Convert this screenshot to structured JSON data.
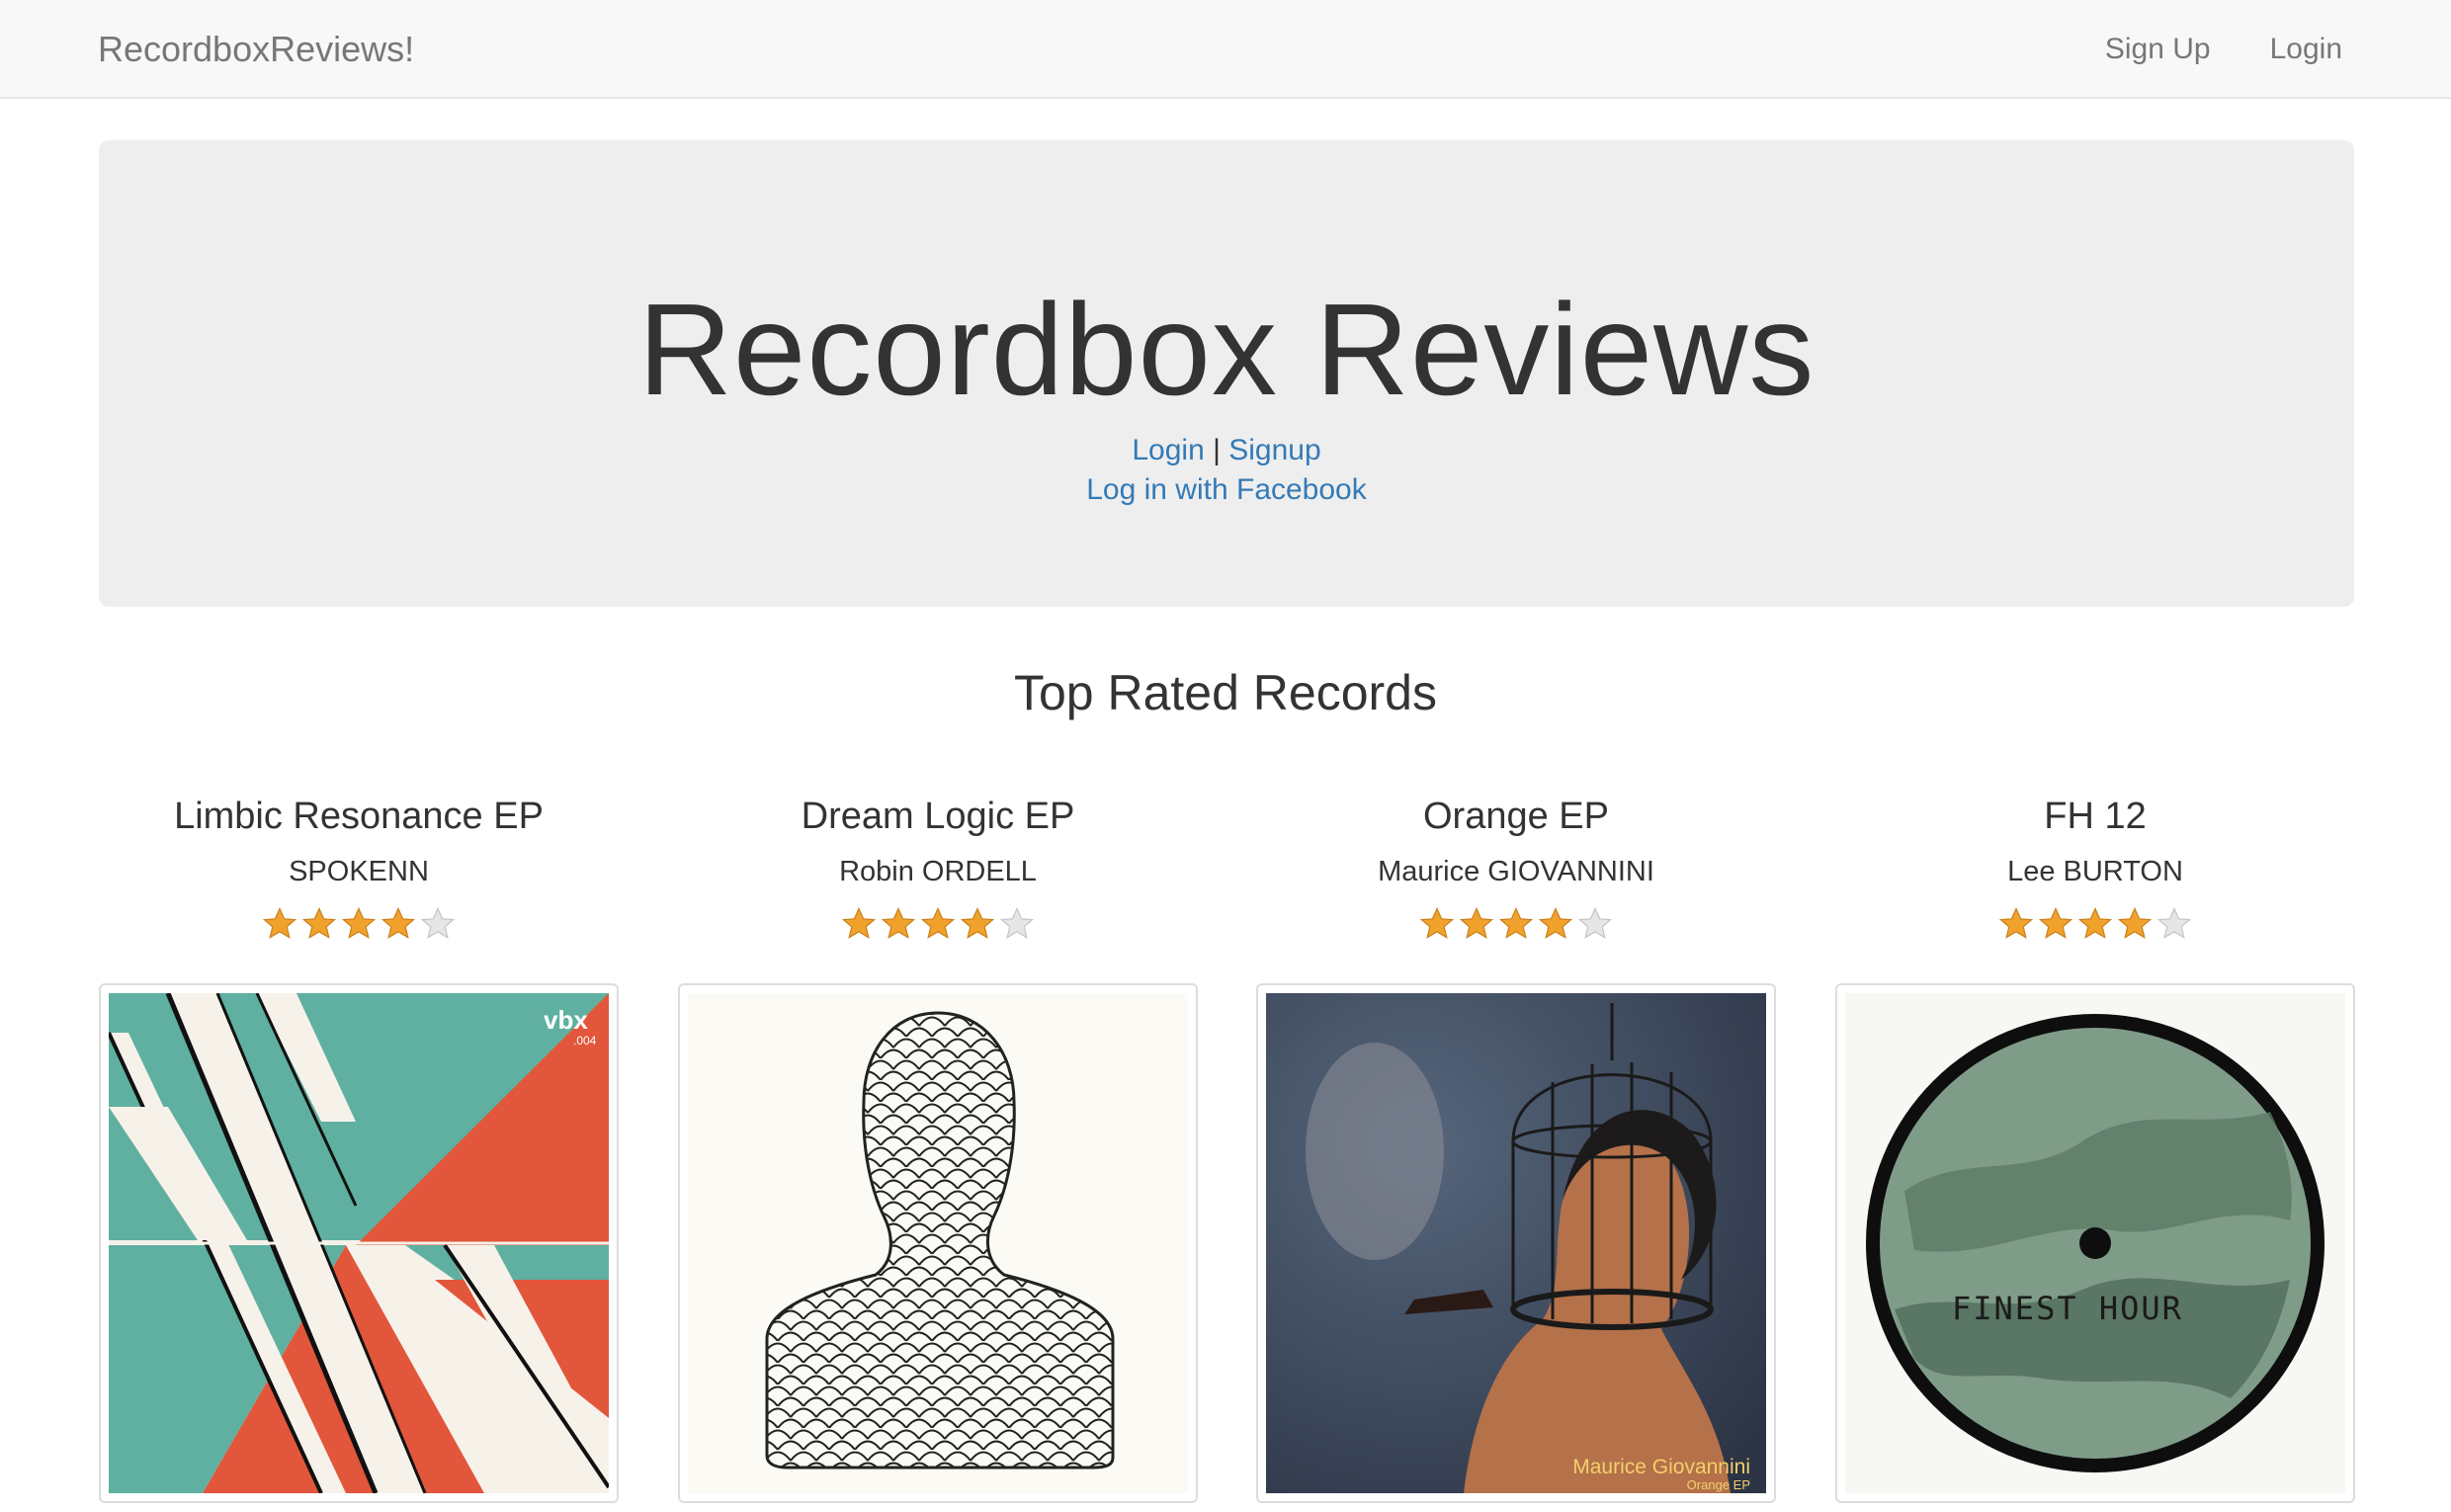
{
  "navbar": {
    "brand": "RecordboxReviews!",
    "links": [
      "Sign Up",
      "Login"
    ]
  },
  "hero": {
    "title": "Recordbox Reviews",
    "login": "Login",
    "separator": "|",
    "signup": "Signup",
    "facebook": "Log in with Facebook"
  },
  "section_title": "Top Rated Records",
  "colors": {
    "star": "#f0a22c",
    "link": "#337ab7"
  },
  "records": [
    {
      "title": "Limbic Resonance EP",
      "artist": "SPOKENN",
      "rating": 4,
      "max_rating": 5,
      "cover": {
        "label": "vbx",
        "catalog": ".004"
      }
    },
    {
      "title": "Dream Logic EP",
      "artist": "Robin ORDELL",
      "rating": 4,
      "max_rating": 5
    },
    {
      "title": "Orange EP",
      "artist": "Maurice GIOVANNINI",
      "rating": 4,
      "max_rating": 5,
      "cover": {
        "name": "Maurice Giovannini",
        "sub": "Orange EP"
      }
    },
    {
      "title": "FH 12",
      "artist": "Lee BURTON",
      "rating": 4,
      "max_rating": 5,
      "cover": {
        "label": "FINEST HOUR"
      }
    }
  ]
}
